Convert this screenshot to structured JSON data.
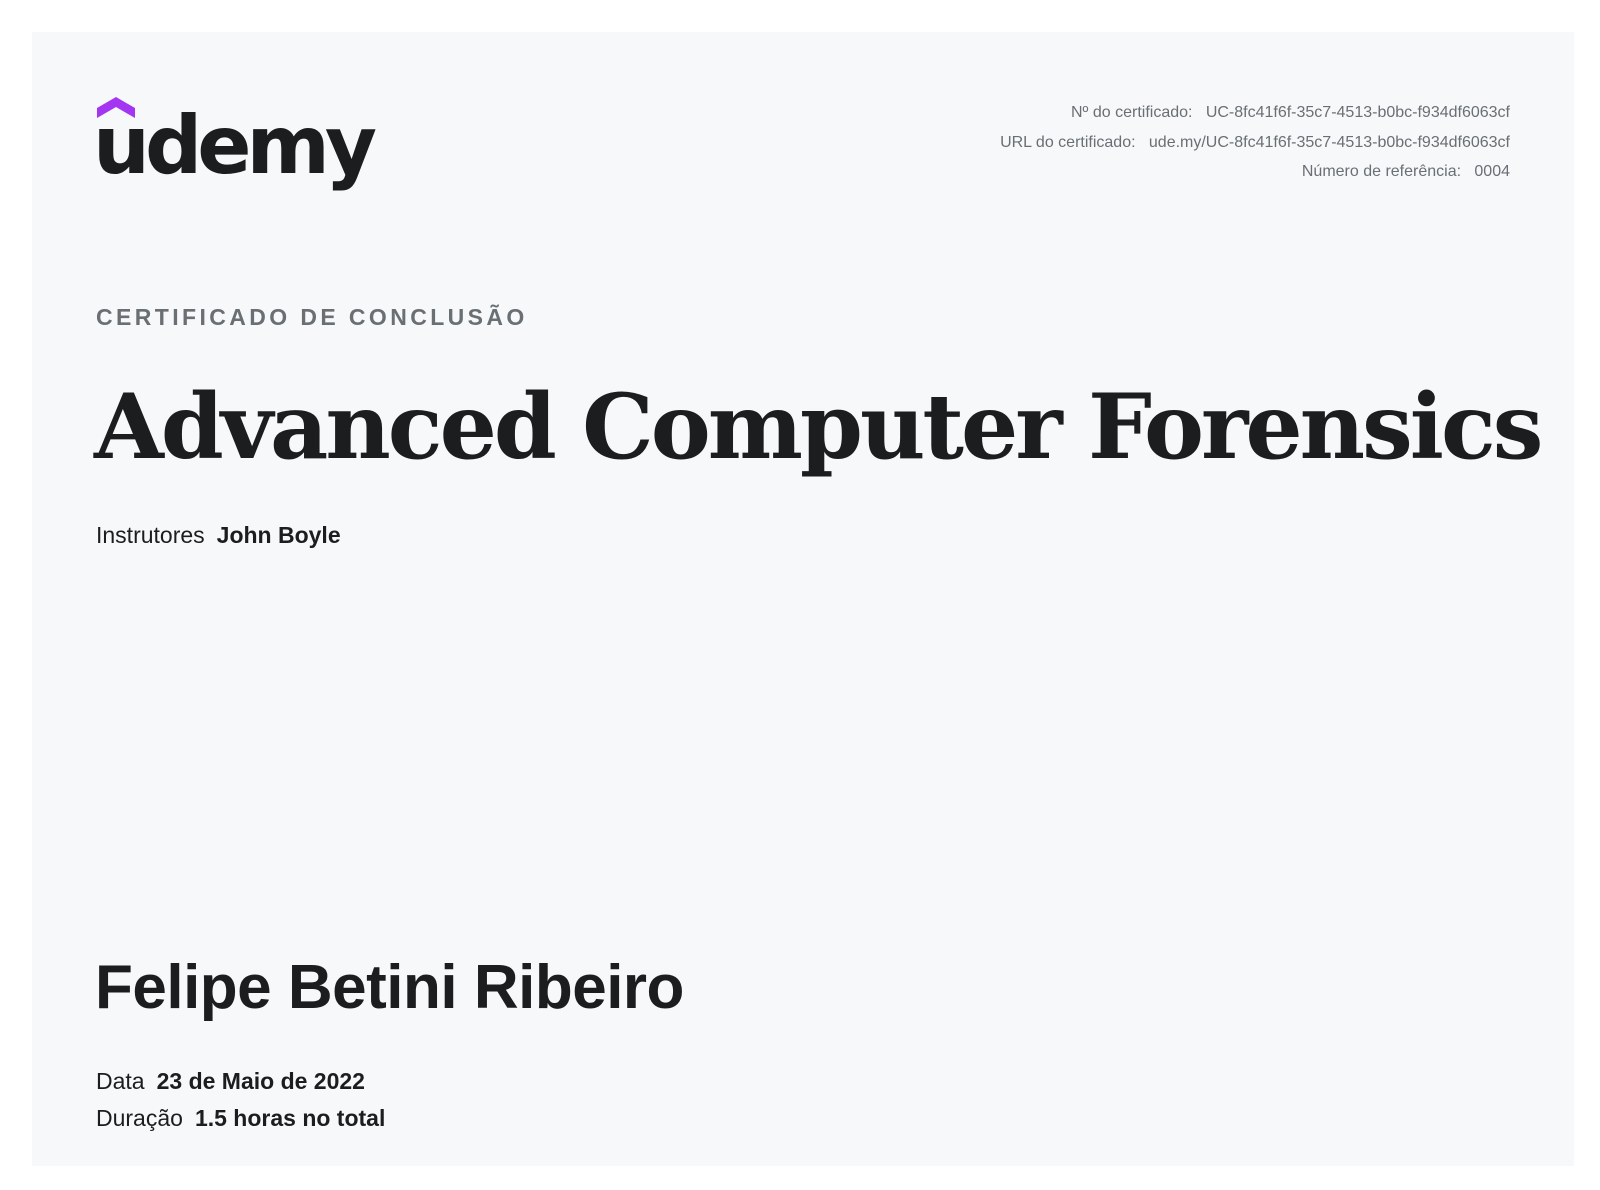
{
  "brand": {
    "name": "udemy",
    "accent_color": "#a435f0",
    "text_color": "#1c1d1f"
  },
  "certificate_meta": {
    "number_label": "Nº do certificado:",
    "number_value": "UC-8fc41f6f-35c7-4513-b0bc-f934df6063cf",
    "url_label": "URL do certificado:",
    "url_value": "ude.my/UC-8fc41f6f-35c7-4513-b0bc-f934df6063cf",
    "reference_label": "Número de referência:",
    "reference_value": "0004"
  },
  "kicker": "CERTIFICADO DE CONCLUSÃO",
  "course_title": "Advanced Computer Forensics",
  "instructors": {
    "label": "Instrutores",
    "value": "John Boyle"
  },
  "student_name": "Felipe Betini Ribeiro",
  "date": {
    "label": "Data",
    "value": "23 de Maio de 2022"
  },
  "duration": {
    "label": "Duração",
    "value": "1.5 horas no total"
  }
}
